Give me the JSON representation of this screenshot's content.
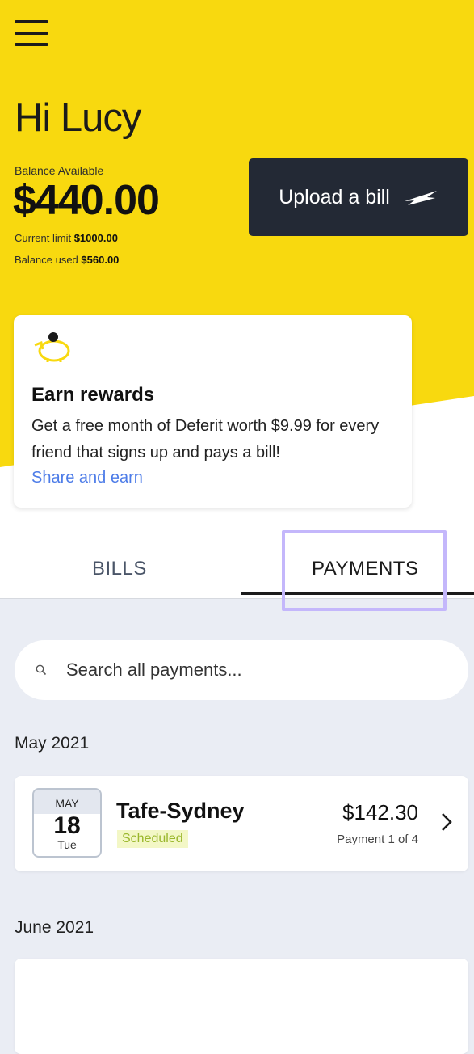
{
  "header": {
    "greeting": "Hi Lucy",
    "balance_label": "Balance Available",
    "balance_amount": "$440.00",
    "current_limit_label": "Current limit",
    "current_limit_value": "$1000.00",
    "balance_used_label": "Balance used",
    "balance_used_value": "$560.00",
    "upload_label": "Upload a bill",
    "accent_color": "#f8d90f"
  },
  "rewards": {
    "title": "Earn rewards",
    "body": "Get a free month of Deferit worth $9.99 for every friend that signs up and pays a bill!",
    "link": "Share and earn",
    "icon": "piggy-bank-icon"
  },
  "tabs": [
    {
      "label": "BILLS",
      "active": false
    },
    {
      "label": "PAYMENTS",
      "active": true
    }
  ],
  "search": {
    "placeholder": "Search all payments..."
  },
  "groups": [
    {
      "month": "May 2021",
      "payments": [
        {
          "cal_month": "MAY",
          "cal_day": "18",
          "cal_weekday": "Tue",
          "payee": "Tafe-Sydney",
          "status": "Scheduled",
          "amount": "$142.30",
          "installment": "Payment 1 of 4"
        }
      ]
    },
    {
      "month": "June 2021",
      "payments": []
    }
  ]
}
